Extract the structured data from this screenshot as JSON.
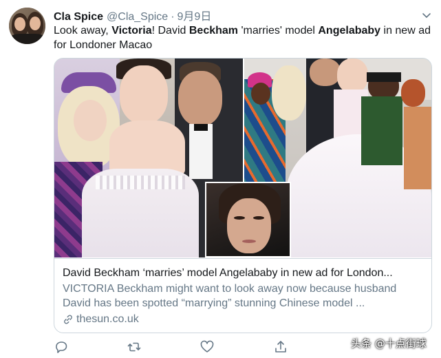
{
  "tweet": {
    "display_name": "Cla Spice",
    "handle": "@Cla_Spice",
    "separator": "·",
    "date": "9月9日",
    "text_parts": [
      "Look away, ",
      "Victoria",
      "! David ",
      "Beckham",
      " 'marries' model ",
      "Angelababy",
      " in new ad for Londoner Macao"
    ]
  },
  "card": {
    "title": "David Beckham ‘marries’ model Angelababy in new ad for London...",
    "description": "VICTORIA Beckham might want to look away now because husband David has been spotted “marrying” stunning Chinese model ...",
    "domain": "thesun.co.uk"
  },
  "actions": {
    "reply": "reply-icon",
    "retweet": "retweet-icon",
    "like": "like-icon",
    "share": "share-icon"
  },
  "watermark": "头条 @十点街球",
  "colors": {
    "text": "#14171a",
    "secondary": "#657786",
    "border": "#ccd6dd",
    "icon": "#657786"
  }
}
